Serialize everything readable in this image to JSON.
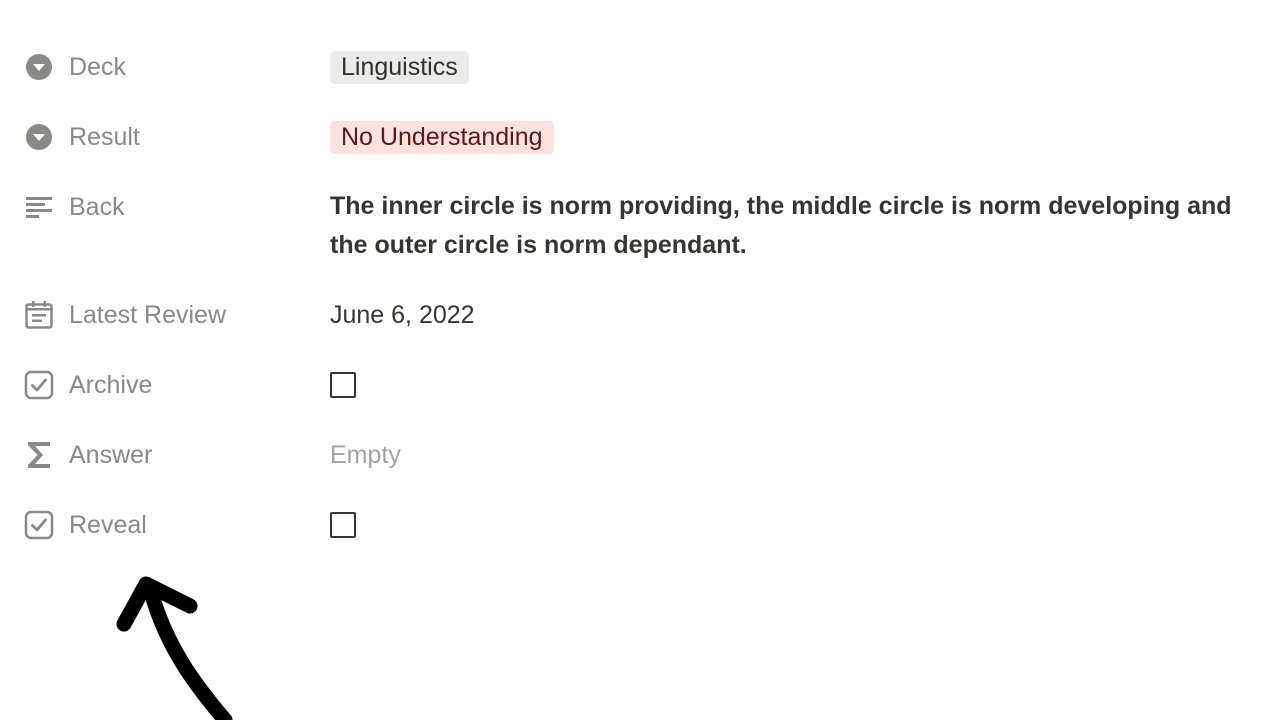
{
  "properties": [
    {
      "key": "deck",
      "label": "Deck",
      "icon": "select-icon",
      "type": "select",
      "value": "Linguistics",
      "tag_color": "gray"
    },
    {
      "key": "result",
      "label": "Result",
      "icon": "select-icon",
      "type": "select",
      "value": "No Understanding",
      "tag_color": "red"
    },
    {
      "key": "back",
      "label": "Back",
      "icon": "text-lines-icon",
      "type": "text",
      "value": "The inner circle is norm providing, the middle circle is norm developing and the outer circle is norm dependant."
    },
    {
      "key": "latest_review",
      "label": "Latest Review",
      "icon": "calendar-icon",
      "type": "date",
      "value": "June 6, 2022"
    },
    {
      "key": "archive",
      "label": "Archive",
      "icon": "checkbox-icon",
      "type": "checkbox",
      "checked": false
    },
    {
      "key": "answer",
      "label": "Answer",
      "icon": "sigma-icon",
      "type": "formula",
      "value": "Empty"
    },
    {
      "key": "reveal",
      "label": "Reveal",
      "icon": "checkbox-icon",
      "type": "checkbox",
      "checked": false
    }
  ],
  "colors": {
    "gray_tag_bg": "#ebebea",
    "red_tag_bg": "#fde2e0",
    "red_tag_text": "#5d1715",
    "label_gray": "#8a8985",
    "arrow": "#000000"
  },
  "annotation": {
    "icon": "curved-arrow-icon"
  }
}
